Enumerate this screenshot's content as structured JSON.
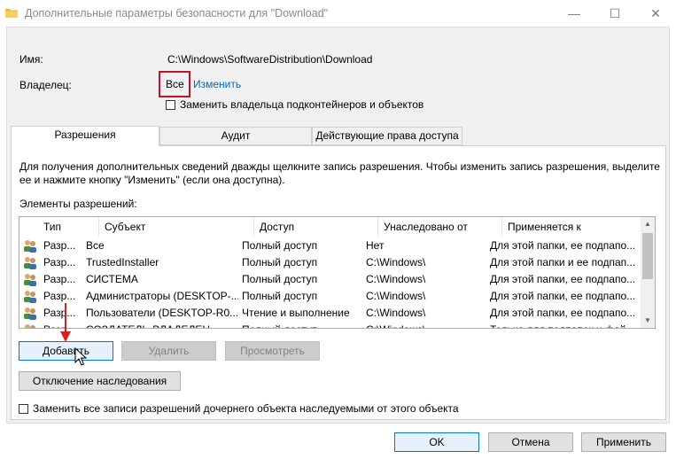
{
  "window": {
    "title": "Дополнительные параметры безопасности  для \"Download\"",
    "minimize_glyph": "—",
    "maximize_glyph": "☐",
    "close_glyph": "✕"
  },
  "name_label": "Имя:",
  "name_value": "C:\\Windows\\SoftwareDistribution\\Download",
  "owner_label": "Владелец:",
  "owner_value": "Все",
  "owner_change_link": "Изменить",
  "replace_owner_checkbox": "Заменить владельца подконтейнеров и объектов",
  "tabs": [
    {
      "label": "Разрешения",
      "active": true
    },
    {
      "label": "Аудит",
      "active": false
    },
    {
      "label": "Действующие права доступа",
      "active": false
    }
  ],
  "info_line1": "Для получения дополнительных сведений дважды щелкните запись разрешения. Чтобы изменить запись разрешения, выделите",
  "info_line2": "ее и нажмите кнопку \"Изменить\" (если она доступна).",
  "permissions_label": "Элементы разрешений:",
  "columns": [
    "Тип",
    "Субъект",
    "Доступ",
    "Унаследовано от",
    "Применяется к"
  ],
  "rows": [
    {
      "type": "Разр...",
      "subject": "Все",
      "access": "Полный доступ",
      "inherited": "Нет",
      "applies": "Для этой папки, ее подпапо..."
    },
    {
      "type": "Разр...",
      "subject": "TrustedInstaller",
      "access": "Полный доступ",
      "inherited": "C:\\Windows\\",
      "applies": "Для этой папки и ее подпап..."
    },
    {
      "type": "Разр...",
      "subject": "СИСТЕМА",
      "access": "Полный доступ",
      "inherited": "C:\\Windows\\",
      "applies": "Для этой папки, ее подпапо..."
    },
    {
      "type": "Разр...",
      "subject": "Администраторы (DESKTOP-...",
      "access": "Полный доступ",
      "inherited": "C:\\Windows\\",
      "applies": "Для этой папки, ее подпапо..."
    },
    {
      "type": "Разр...",
      "subject": "Пользователи (DESKTOP-R0...",
      "access": "Чтение и выполнение",
      "inherited": "C:\\Windows\\",
      "applies": "Для этой папки, ее подпапо..."
    },
    {
      "type": "Разр...",
      "subject": "СОЗДАТЕЛЬ-ВЛАДЕЛЕЦ",
      "access": "Полный доступ",
      "inherited": "C:\\Windows\\",
      "applies": "Только для подпапок и фай..."
    }
  ],
  "buttons": {
    "add": "Добавить",
    "remove": "Удалить",
    "view": "Просмотреть",
    "disable_inheritance": "Отключение наследования",
    "ok": "OK",
    "cancel": "Отмена",
    "apply": "Применить"
  },
  "replace_child_checkbox": "Заменить все записи разрешений дочернего объекта наследуемыми от этого объекта",
  "colors": {
    "highlight": "#c8102e",
    "link": "#0066cc",
    "focus": "#0078d7"
  }
}
